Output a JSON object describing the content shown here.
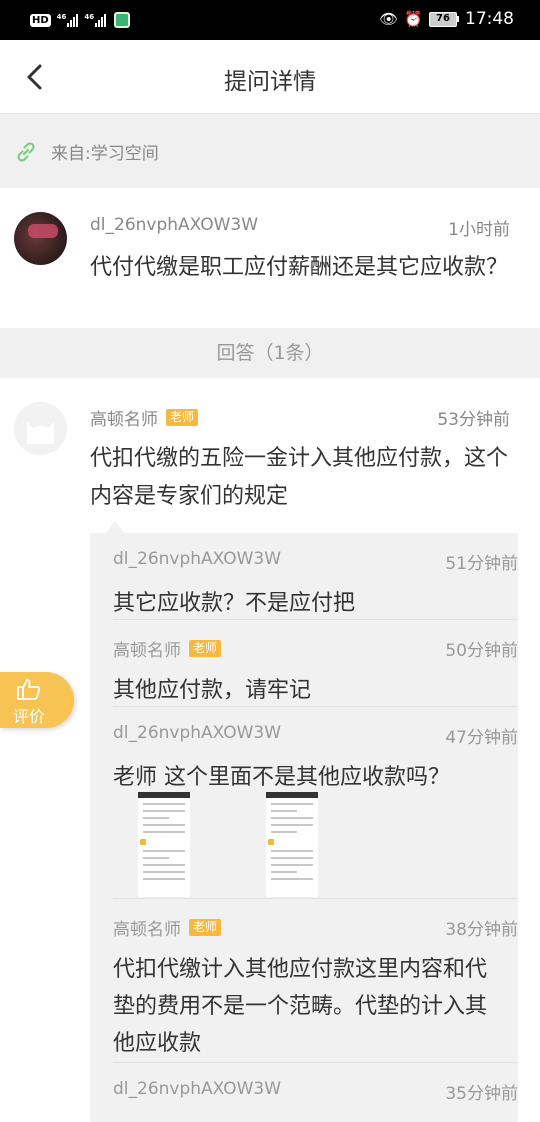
{
  "status_bar": {
    "hd_label": "HD",
    "network_1": "46",
    "network_2": "46",
    "battery_level": "76",
    "time": "17:48"
  },
  "nav": {
    "title": "提问详情"
  },
  "source": {
    "text": "来自:学习空间"
  },
  "question": {
    "user": "dl_26nvphAXOW3W",
    "time": "1小时前",
    "text": "代付代缴是职工应付薪酬还是其它应收款？"
  },
  "answers_header": "回答（1条）",
  "answer": {
    "user": "高顿名师",
    "badge": "老师",
    "time": "53分钟前",
    "text": "代扣代缴的五险一金计入其他应付款，这个内容是专家们的规定"
  },
  "thread": [
    {
      "user": "dl_26nvphAXOW3W",
      "badge": "",
      "time": "51分钟前",
      "text": "其它应收款？不是应付把"
    },
    {
      "user": "高顿名师",
      "badge": "老师",
      "time": "50分钟前",
      "text": "其他应付款，请牢记"
    },
    {
      "user": "dl_26nvphAXOW3W",
      "badge": "",
      "time": "47分钟前",
      "text": "老师 这个里面不是其他应收款吗？"
    },
    {
      "user": "高顿名师",
      "badge": "老师",
      "time": "38分钟前",
      "text": "代扣代缴计入其他应付款这里内容和代垫的费用不是一个范畴。代垫的计入其他应收款"
    },
    {
      "user": "dl_26nvphAXOW3W",
      "badge": "",
      "time": "35分钟前",
      "text": ""
    }
  ],
  "eval_button": {
    "label": "评价"
  },
  "colors": {
    "accent": "#f7c352",
    "badge": "#f5b942",
    "link_icon": "#7bc97b"
  }
}
